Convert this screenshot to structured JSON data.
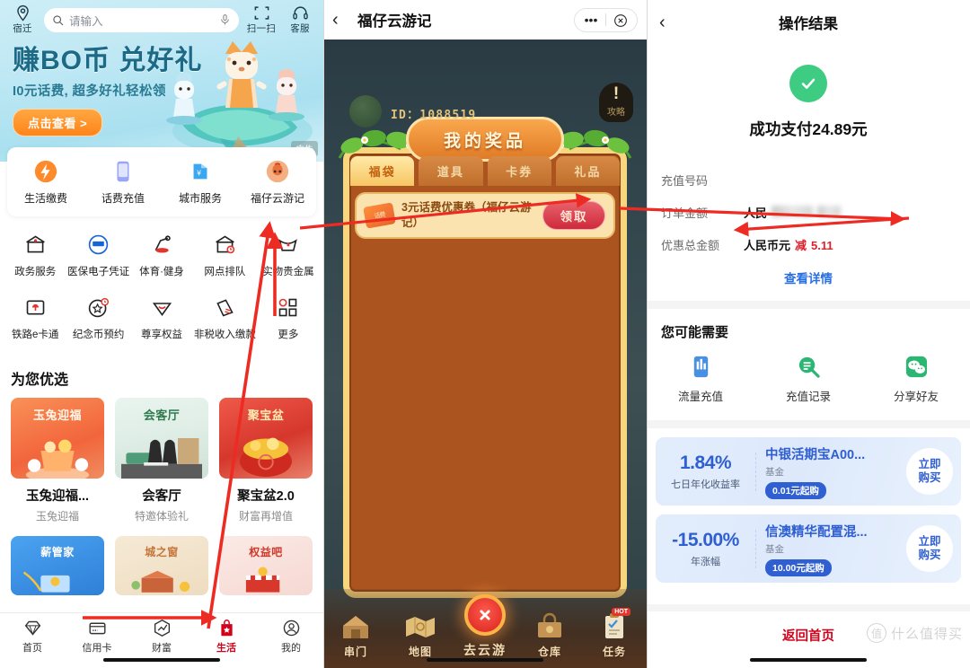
{
  "left": {
    "location": "宿迁",
    "search": {
      "placeholder": "请输入",
      "icon": "search-icon",
      "mic": "microphone-icon"
    },
    "scan": "扫一扫",
    "service": "客服",
    "hero": {
      "headline": "赚BO币 兑好礼",
      "subline": "I0元话费, 超多好礼轻松领",
      "cta": "点击查看 >",
      "ad_tag": "广告"
    },
    "quick_services": [
      {
        "label": "生活缴费",
        "icon": "utility-payment-icon"
      },
      {
        "label": "话费充值",
        "icon": "phone-topup-icon"
      },
      {
        "label": "城市服务",
        "icon": "city-service-icon"
      },
      {
        "label": "福仔云游记",
        "icon": "fuzai-game-icon"
      }
    ],
    "grid": [
      [
        {
          "label": "政务服务",
          "icon": "government-icon"
        },
        {
          "label": "医保电子凭证",
          "icon": "medical-insurance-icon"
        },
        {
          "label": "体育·健身",
          "icon": "fitness-icon"
        },
        {
          "label": "网点排队",
          "icon": "branch-queue-icon"
        },
        {
          "label": "实物贵金属",
          "icon": "precious-metal-icon"
        }
      ],
      [
        {
          "label": "铁路e卡通",
          "icon": "railway-card-icon"
        },
        {
          "label": "纪念币预约",
          "icon": "coin-reservation-icon"
        },
        {
          "label": "尊享权益",
          "icon": "privilege-icon"
        },
        {
          "label": "非税收入缴款",
          "icon": "nontax-payment-icon"
        },
        {
          "label": "更多",
          "icon": "more-icon"
        }
      ]
    ],
    "section_title": "为您优选",
    "cards": [
      {
        "badge": "玉兔迎福",
        "title": "玉兔迎福...",
        "sub": "玉兔迎福"
      },
      {
        "badge": "会客厅",
        "title": "会客厅",
        "sub": "特邀体验礼"
      },
      {
        "badge": "聚宝盆",
        "title": "聚宝盆2.0",
        "sub": "财富再增值"
      }
    ],
    "cards2": [
      {
        "badge": "薪管家"
      },
      {
        "badge": "城之窗"
      },
      {
        "badge": "权益吧"
      }
    ],
    "tabs": [
      {
        "label": "首页",
        "icon": "diamond-icon",
        "active": false
      },
      {
        "label": "信用卡",
        "icon": "credit-card-icon",
        "active": false
      },
      {
        "label": "财富",
        "icon": "wealth-icon",
        "active": false
      },
      {
        "label": "生活",
        "icon": "life-bag-icon",
        "active": true
      },
      {
        "label": "我的",
        "icon": "profile-icon",
        "active": false
      }
    ]
  },
  "middle": {
    "header": {
      "back": "‹",
      "title": "福仔云游记",
      "more": "•••",
      "close": "close-icon"
    },
    "player_id": "ID：1088519",
    "guide": {
      "mark": "!",
      "label": "攻略"
    },
    "board_title": "我的奖品",
    "game_tabs": [
      {
        "label": "福袋",
        "active": true
      },
      {
        "label": "道具",
        "active": false
      },
      {
        "label": "卡券",
        "active": false
      },
      {
        "label": "礼品",
        "active": false
      }
    ],
    "prize": {
      "icon_text": "话费",
      "name": "3元话费优惠券（福仔云游记）",
      "button": "领取"
    },
    "bottom_nav": [
      {
        "label": "串门",
        "icon": "house-visit-icon"
      },
      {
        "label": "地图",
        "icon": "map-icon"
      },
      {
        "label": "去云游",
        "icon": "close-x-icon",
        "center": true
      },
      {
        "label": "仓库",
        "icon": "warehouse-icon"
      },
      {
        "label": "任务",
        "icon": "task-icon",
        "badge": "HOT"
      }
    ]
  },
  "right": {
    "header": {
      "back": "‹",
      "title": "操作结果"
    },
    "result": {
      "icon": "check-circle-icon",
      "text": "成功支付24.89元"
    },
    "rows": [
      {
        "key": "充值号码",
        "value": "",
        "masked": false
      },
      {
        "key": "订单金额",
        "value": "人民",
        "masked": true
      },
      {
        "key": "优惠总金额",
        "value": "人民币元",
        "discount_label": "减",
        "discount": "5.11",
        "masked": false
      }
    ],
    "detail_link": "查看详情",
    "needs_title": "您可能需要",
    "needs": [
      {
        "label": "流量充值",
        "icon": "data-plan-icon"
      },
      {
        "label": "充值记录",
        "icon": "recharge-history-icon"
      },
      {
        "label": "分享好友",
        "icon": "wechat-share-icon"
      }
    ],
    "funds": [
      {
        "percent": "1.84%",
        "percent_label": "七日年化收益率",
        "name": "中银活期宝A00...",
        "type": "基金",
        "min": "0.01元起购",
        "buy": "立即购买"
      },
      {
        "percent": "-15.00%",
        "percent_label": "年涨幅",
        "name": "信澳精华配置混...",
        "type": "基金",
        "min": "10.00元起购",
        "buy": "立即购买"
      }
    ],
    "home_link": "返回首页",
    "watermark": {
      "mark": "值",
      "text": "什么值得买"
    }
  },
  "colors": {
    "accent_red": "#d0021b",
    "success_green": "#3ecb82",
    "fund_blue": "#2f5fd0",
    "arrow_red": "#ee2b22"
  }
}
